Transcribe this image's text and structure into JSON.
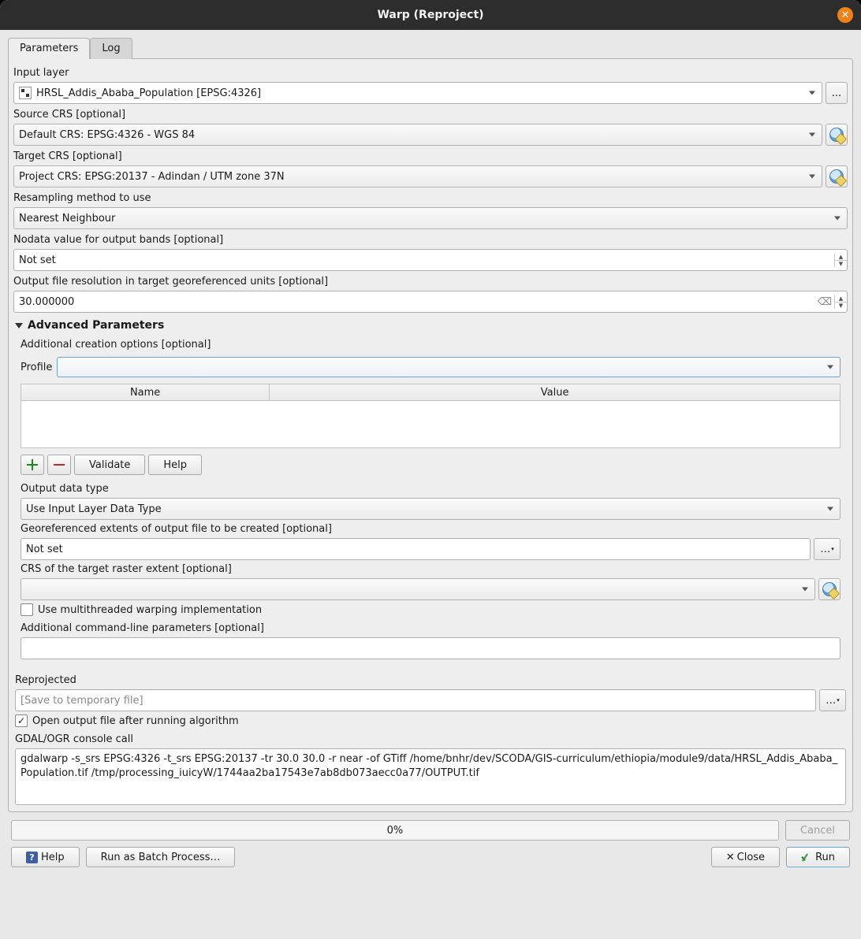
{
  "window": {
    "title": "Warp (Reproject)"
  },
  "tabs": {
    "parameters": "Parameters",
    "log": "Log"
  },
  "labels": {
    "input_layer": "Input layer",
    "source_crs": "Source CRS [optional]",
    "target_crs": "Target CRS [optional]",
    "resampling": "Resampling method to use",
    "nodata": "Nodata value for output bands [optional]",
    "out_res": "Output file resolution in target georeferenced units [optional]",
    "advanced": "Advanced Parameters",
    "add_creation": "Additional creation options [optional]",
    "profile": "Profile",
    "col_name": "Name",
    "col_value": "Value",
    "validate": "Validate",
    "help_btn": "Help",
    "out_dtype": "Output data type",
    "geo_ext": "Georeferenced extents of output file to be created [optional]",
    "crs_ext": "CRS of the target raster extent [optional]",
    "multithread": "Use multithreaded warping implementation",
    "cmdline": "Additional command-line parameters [optional]",
    "reprojected": "Reprojected",
    "open_after": "Open output file after running algorithm",
    "console_call": "GDAL/OGR console call"
  },
  "values": {
    "input_layer": "HRSL_Addis_Ababa_Population [EPSG:4326]",
    "source_crs": "Default CRS: EPSG:4326 - WGS 84",
    "target_crs": "Project CRS: EPSG:20137 - Adindan / UTM zone 37N",
    "resampling": "Nearest Neighbour",
    "nodata": "Not set",
    "out_res": "30.000000",
    "out_dtype": "Use Input Layer Data Type",
    "geo_ext": "Not set",
    "reprojected_placeholder": "[Save to temporary file]",
    "open_after_checked": true,
    "multithread_checked": false,
    "console": "gdalwarp -s_srs EPSG:4326 -t_srs EPSG:20137 -tr 30.0 30.0 -r near -of GTiff /home/bnhr/dev/SCODA/GIS-curriculum/ethiopia/module9/data/HRSL_Addis_Ababa_Population.tif /tmp/processing_iuicyW/1744aa2ba17543e7ab8db073aecc0a77/OUTPUT.tif"
  },
  "progress": {
    "text": "0%"
  },
  "footer": {
    "cancel": "Cancel",
    "help": "Help",
    "batch": "Run as Batch Process…",
    "close": "Close",
    "run": "Run"
  },
  "misc": {
    "ellipsis": "…",
    "ellipsis_dots": "..."
  }
}
